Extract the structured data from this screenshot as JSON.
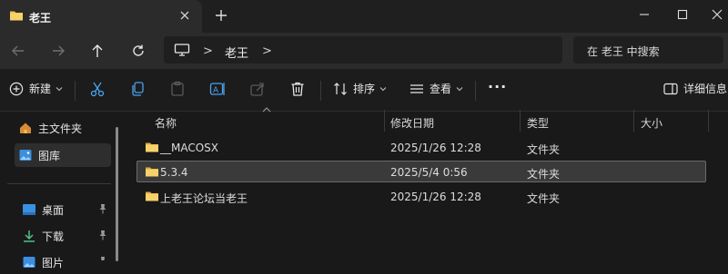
{
  "window": {
    "tab_title": "老王",
    "tab_icon": "folder-icon",
    "controls": [
      "minimize-icon",
      "maximize-icon",
      "close-icon"
    ]
  },
  "nav": {
    "buttons": [
      "back-icon",
      "forward-icon",
      "up-icon",
      "refresh-icon"
    ],
    "address": {
      "root_icon": "computer-icon",
      "crumb": "老王",
      "separator": ">"
    },
    "search_placeholder": "在 老王 中搜索"
  },
  "toolbar": {
    "new_label": "新建",
    "icons": [
      "cut-icon",
      "copy-icon",
      "paste-icon",
      "rename-icon",
      "share-icon",
      "delete-icon"
    ],
    "sort_label": "排序",
    "view_label": "查看",
    "more_label": "···",
    "details_label": "详细信息"
  },
  "sidebar": {
    "items": [
      {
        "label": "主文件夹",
        "icon": "home-icon"
      },
      {
        "label": "图库",
        "icon": "gallery-icon",
        "selected": true
      }
    ],
    "pinned": [
      {
        "label": "桌面",
        "icon": "desktop-icon",
        "pinned": true
      },
      {
        "label": "下载",
        "icon": "download-icon",
        "pinned": true
      },
      {
        "label": "图片",
        "icon": "pictures-icon",
        "pinned": true
      }
    ]
  },
  "files": {
    "columns": [
      "名称",
      "修改日期",
      "类型",
      "大小"
    ],
    "rows": [
      {
        "name": "__MACOSX",
        "modified": "2025/1/26 12:28",
        "type": "文件夹",
        "size": ""
      },
      {
        "name": "5.3.4",
        "modified": "2025/5/4 0:56",
        "type": "文件夹",
        "size": "",
        "selected": true
      },
      {
        "name": "上老王论坛当老王",
        "modified": "2025/1/26 12:28",
        "type": "文件夹",
        "size": ""
      }
    ]
  },
  "colors": {
    "background": "#191919",
    "toolbar": "#1c1c1c",
    "folder": "#f2c14e",
    "accent": "#4aa3f0",
    "selection": "#3a3a3a"
  }
}
